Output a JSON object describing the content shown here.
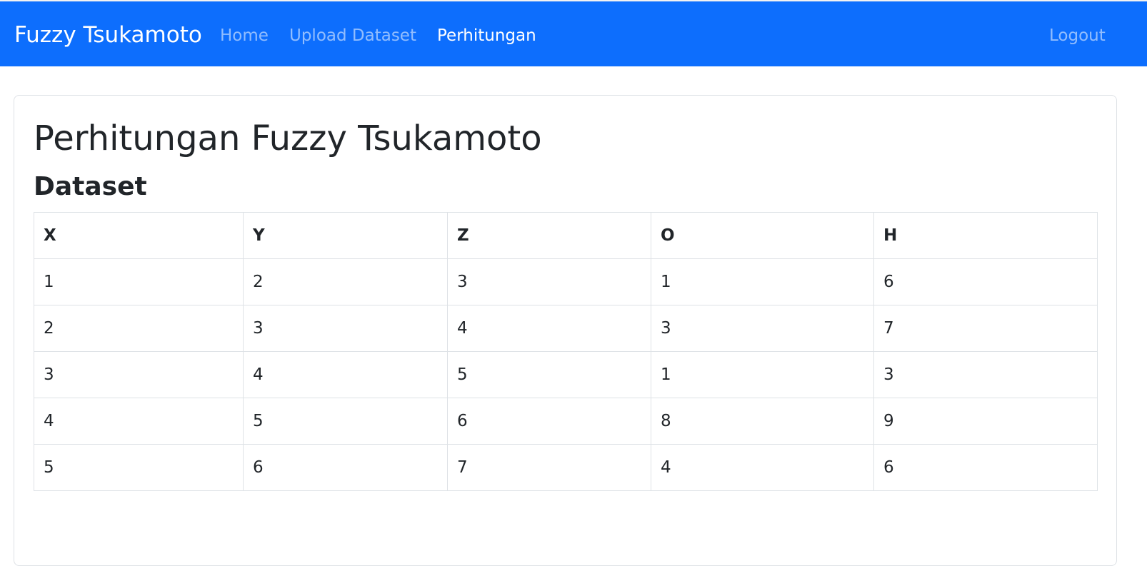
{
  "navbar": {
    "brand": "Fuzzy Tsukamoto",
    "links": [
      {
        "label": "Home",
        "active": false
      },
      {
        "label": "Upload Dataset",
        "active": false
      },
      {
        "label": "Perhitungan",
        "active": true
      }
    ],
    "logout": "Logout"
  },
  "page": {
    "title": "Perhitungan Fuzzy Tsukamoto",
    "section_title": "Dataset"
  },
  "table": {
    "headers": [
      "X",
      "Y",
      "Z",
      "O",
      "H"
    ],
    "rows": [
      [
        "1",
        "2",
        "3",
        "1",
        "6"
      ],
      [
        "2",
        "3",
        "4",
        "3",
        "7"
      ],
      [
        "3",
        "4",
        "5",
        "1",
        "3"
      ],
      [
        "4",
        "5",
        "6",
        "8",
        "9"
      ],
      [
        "5",
        "6",
        "7",
        "4",
        "6"
      ]
    ]
  },
  "colors": {
    "navbar_bg": "#0d6efd",
    "border": "#dee2e6",
    "text": "#212529"
  }
}
